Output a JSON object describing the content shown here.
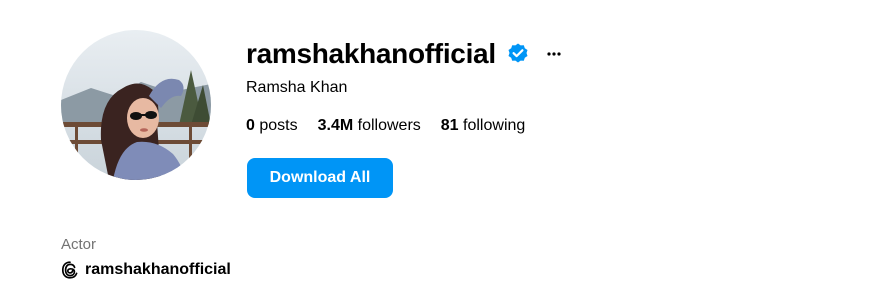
{
  "profile": {
    "username": "ramshakhanofficial",
    "full_name": "Ramsha Khan",
    "verified": true,
    "verified_icon": "verified-badge-icon",
    "more_icon": "more-options-icon",
    "avatar_alt": "profile-photo"
  },
  "stats": {
    "posts_count": "0",
    "posts_label": "posts",
    "followers_count": "3.4M",
    "followers_label": "followers",
    "following_count": "81",
    "following_label": "following"
  },
  "actions": {
    "download_label": "Download All"
  },
  "bio": {
    "category": "Actor",
    "threads_icon": "threads-icon",
    "threads_handle": "ramshakhanofficial"
  },
  "colors": {
    "accent": "#0095f6",
    "verified": "#0095f6",
    "muted_text": "#737373",
    "text": "#000000",
    "background": "#ffffff"
  }
}
